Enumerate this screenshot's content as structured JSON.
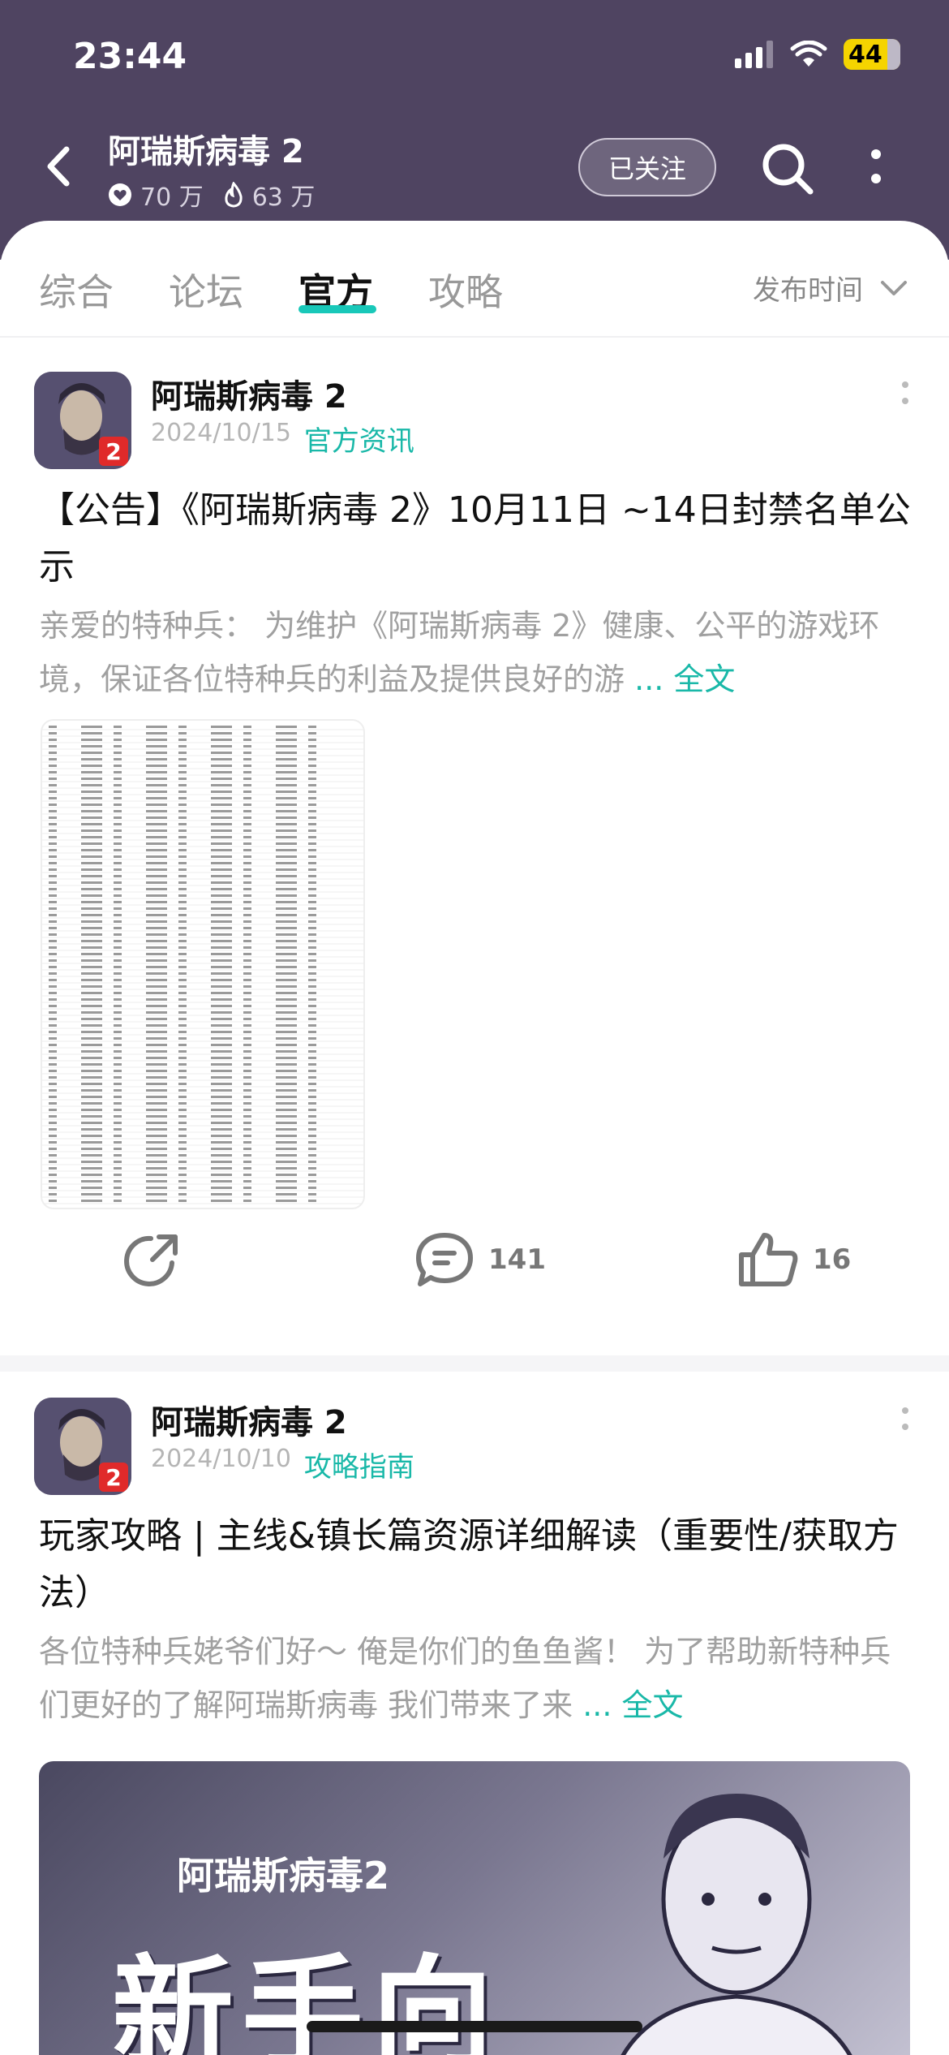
{
  "status_bar": {
    "time": "23:44",
    "battery": "44"
  },
  "nav": {
    "title": "阿瑞斯病毒 2",
    "followers": "70 万",
    "heat": "63 万",
    "follow_label": "已关注"
  },
  "tabs": [
    {
      "label": "综合"
    },
    {
      "label": "论坛"
    },
    {
      "label": "官方"
    },
    {
      "label": "攻略"
    }
  ],
  "active_tab": "官方",
  "sort_label": "发布时间",
  "posts": [
    {
      "author": "阿瑞斯病毒 2",
      "date": "2024/10/15",
      "category": "官方资讯",
      "title": "【公告】《阿瑞斯病毒 2》10月11日 ~14日封禁名单公示",
      "excerpt": "亲爱的特种兵：  为维护《阿瑞斯病毒 2》健康、公平的游戏环境，保证各位特种兵的利益及提供良好的游",
      "more_label": "... 全文",
      "comments": "141",
      "likes": "16"
    },
    {
      "author": "阿瑞斯病毒 2",
      "date": "2024/10/10",
      "category": "攻略指南",
      "title": "玩家攻略 | 主线&镇长篇资源详细解读（重要性/获取方法）",
      "excerpt": "各位特种兵姥爷们好～ 俺是你们的鱼鱼酱！  为了帮助新特种兵们更好的了解阿瑞斯病毒  我们带来了来",
      "more_label": "... 全文",
      "banner_subtitle": "阿瑞斯病毒2",
      "banner_main": "新手向"
    }
  ],
  "colors": {
    "header": "#4f4461",
    "accent": "#19b8a8"
  }
}
